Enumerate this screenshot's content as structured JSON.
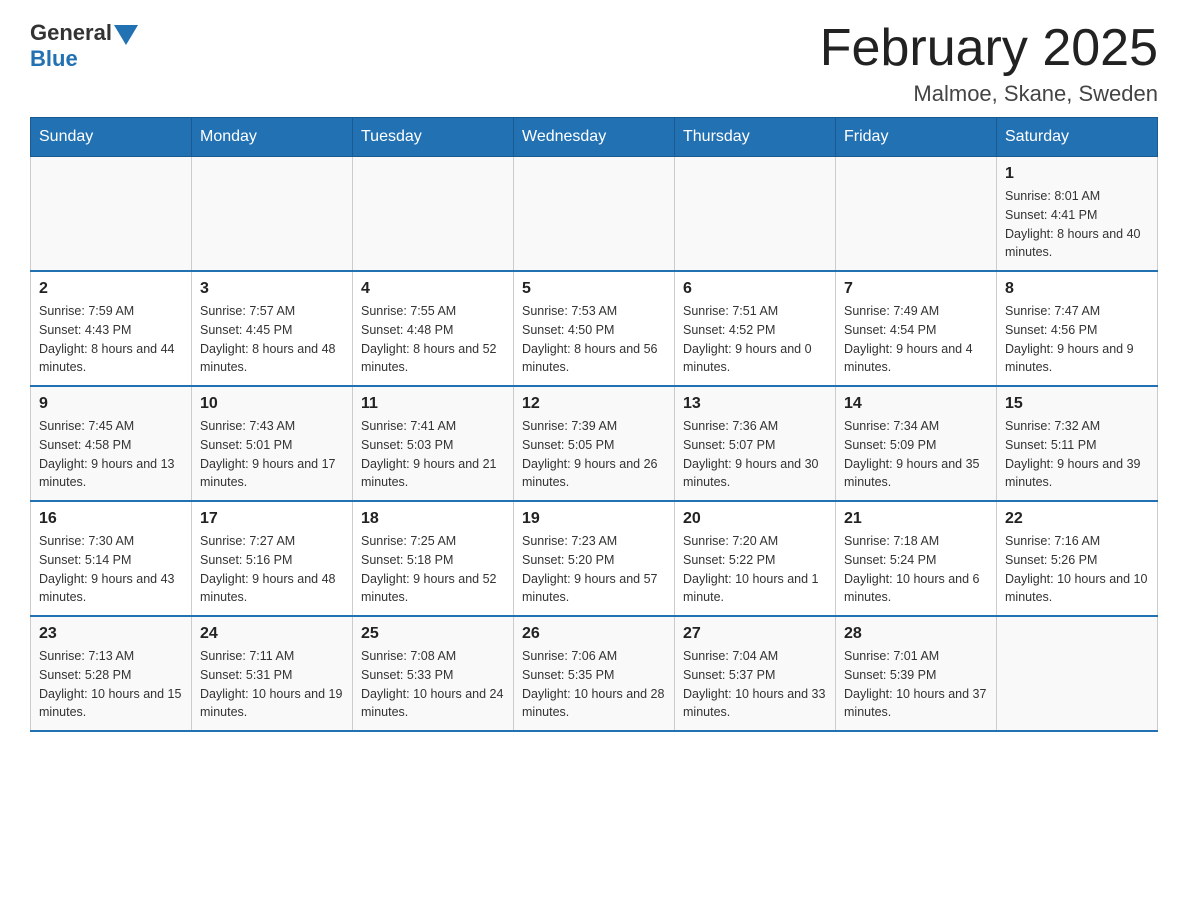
{
  "header": {
    "logo_general": "General",
    "logo_blue": "Blue",
    "title": "February 2025",
    "subtitle": "Malmoe, Skane, Sweden"
  },
  "weekdays": [
    "Sunday",
    "Monday",
    "Tuesday",
    "Wednesday",
    "Thursday",
    "Friday",
    "Saturday"
  ],
  "weeks": [
    [
      {
        "day": "",
        "sunrise": "",
        "sunset": "",
        "daylight": ""
      },
      {
        "day": "",
        "sunrise": "",
        "sunset": "",
        "daylight": ""
      },
      {
        "day": "",
        "sunrise": "",
        "sunset": "",
        "daylight": ""
      },
      {
        "day": "",
        "sunrise": "",
        "sunset": "",
        "daylight": ""
      },
      {
        "day": "",
        "sunrise": "",
        "sunset": "",
        "daylight": ""
      },
      {
        "day": "",
        "sunrise": "",
        "sunset": "",
        "daylight": ""
      },
      {
        "day": "1",
        "sunrise": "Sunrise: 8:01 AM",
        "sunset": "Sunset: 4:41 PM",
        "daylight": "Daylight: 8 hours and 40 minutes."
      }
    ],
    [
      {
        "day": "2",
        "sunrise": "Sunrise: 7:59 AM",
        "sunset": "Sunset: 4:43 PM",
        "daylight": "Daylight: 8 hours and 44 minutes."
      },
      {
        "day": "3",
        "sunrise": "Sunrise: 7:57 AM",
        "sunset": "Sunset: 4:45 PM",
        "daylight": "Daylight: 8 hours and 48 minutes."
      },
      {
        "day": "4",
        "sunrise": "Sunrise: 7:55 AM",
        "sunset": "Sunset: 4:48 PM",
        "daylight": "Daylight: 8 hours and 52 minutes."
      },
      {
        "day": "5",
        "sunrise": "Sunrise: 7:53 AM",
        "sunset": "Sunset: 4:50 PM",
        "daylight": "Daylight: 8 hours and 56 minutes."
      },
      {
        "day": "6",
        "sunrise": "Sunrise: 7:51 AM",
        "sunset": "Sunset: 4:52 PM",
        "daylight": "Daylight: 9 hours and 0 minutes."
      },
      {
        "day": "7",
        "sunrise": "Sunrise: 7:49 AM",
        "sunset": "Sunset: 4:54 PM",
        "daylight": "Daylight: 9 hours and 4 minutes."
      },
      {
        "day": "8",
        "sunrise": "Sunrise: 7:47 AM",
        "sunset": "Sunset: 4:56 PM",
        "daylight": "Daylight: 9 hours and 9 minutes."
      }
    ],
    [
      {
        "day": "9",
        "sunrise": "Sunrise: 7:45 AM",
        "sunset": "Sunset: 4:58 PM",
        "daylight": "Daylight: 9 hours and 13 minutes."
      },
      {
        "day": "10",
        "sunrise": "Sunrise: 7:43 AM",
        "sunset": "Sunset: 5:01 PM",
        "daylight": "Daylight: 9 hours and 17 minutes."
      },
      {
        "day": "11",
        "sunrise": "Sunrise: 7:41 AM",
        "sunset": "Sunset: 5:03 PM",
        "daylight": "Daylight: 9 hours and 21 minutes."
      },
      {
        "day": "12",
        "sunrise": "Sunrise: 7:39 AM",
        "sunset": "Sunset: 5:05 PM",
        "daylight": "Daylight: 9 hours and 26 minutes."
      },
      {
        "day": "13",
        "sunrise": "Sunrise: 7:36 AM",
        "sunset": "Sunset: 5:07 PM",
        "daylight": "Daylight: 9 hours and 30 minutes."
      },
      {
        "day": "14",
        "sunrise": "Sunrise: 7:34 AM",
        "sunset": "Sunset: 5:09 PM",
        "daylight": "Daylight: 9 hours and 35 minutes."
      },
      {
        "day": "15",
        "sunrise": "Sunrise: 7:32 AM",
        "sunset": "Sunset: 5:11 PM",
        "daylight": "Daylight: 9 hours and 39 minutes."
      }
    ],
    [
      {
        "day": "16",
        "sunrise": "Sunrise: 7:30 AM",
        "sunset": "Sunset: 5:14 PM",
        "daylight": "Daylight: 9 hours and 43 minutes."
      },
      {
        "day": "17",
        "sunrise": "Sunrise: 7:27 AM",
        "sunset": "Sunset: 5:16 PM",
        "daylight": "Daylight: 9 hours and 48 minutes."
      },
      {
        "day": "18",
        "sunrise": "Sunrise: 7:25 AM",
        "sunset": "Sunset: 5:18 PM",
        "daylight": "Daylight: 9 hours and 52 minutes."
      },
      {
        "day": "19",
        "sunrise": "Sunrise: 7:23 AM",
        "sunset": "Sunset: 5:20 PM",
        "daylight": "Daylight: 9 hours and 57 minutes."
      },
      {
        "day": "20",
        "sunrise": "Sunrise: 7:20 AM",
        "sunset": "Sunset: 5:22 PM",
        "daylight": "Daylight: 10 hours and 1 minute."
      },
      {
        "day": "21",
        "sunrise": "Sunrise: 7:18 AM",
        "sunset": "Sunset: 5:24 PM",
        "daylight": "Daylight: 10 hours and 6 minutes."
      },
      {
        "day": "22",
        "sunrise": "Sunrise: 7:16 AM",
        "sunset": "Sunset: 5:26 PM",
        "daylight": "Daylight: 10 hours and 10 minutes."
      }
    ],
    [
      {
        "day": "23",
        "sunrise": "Sunrise: 7:13 AM",
        "sunset": "Sunset: 5:28 PM",
        "daylight": "Daylight: 10 hours and 15 minutes."
      },
      {
        "day": "24",
        "sunrise": "Sunrise: 7:11 AM",
        "sunset": "Sunset: 5:31 PM",
        "daylight": "Daylight: 10 hours and 19 minutes."
      },
      {
        "day": "25",
        "sunrise": "Sunrise: 7:08 AM",
        "sunset": "Sunset: 5:33 PM",
        "daylight": "Daylight: 10 hours and 24 minutes."
      },
      {
        "day": "26",
        "sunrise": "Sunrise: 7:06 AM",
        "sunset": "Sunset: 5:35 PM",
        "daylight": "Daylight: 10 hours and 28 minutes."
      },
      {
        "day": "27",
        "sunrise": "Sunrise: 7:04 AM",
        "sunset": "Sunset: 5:37 PM",
        "daylight": "Daylight: 10 hours and 33 minutes."
      },
      {
        "day": "28",
        "sunrise": "Sunrise: 7:01 AM",
        "sunset": "Sunset: 5:39 PM",
        "daylight": "Daylight: 10 hours and 37 minutes."
      },
      {
        "day": "",
        "sunrise": "",
        "sunset": "",
        "daylight": ""
      }
    ]
  ]
}
